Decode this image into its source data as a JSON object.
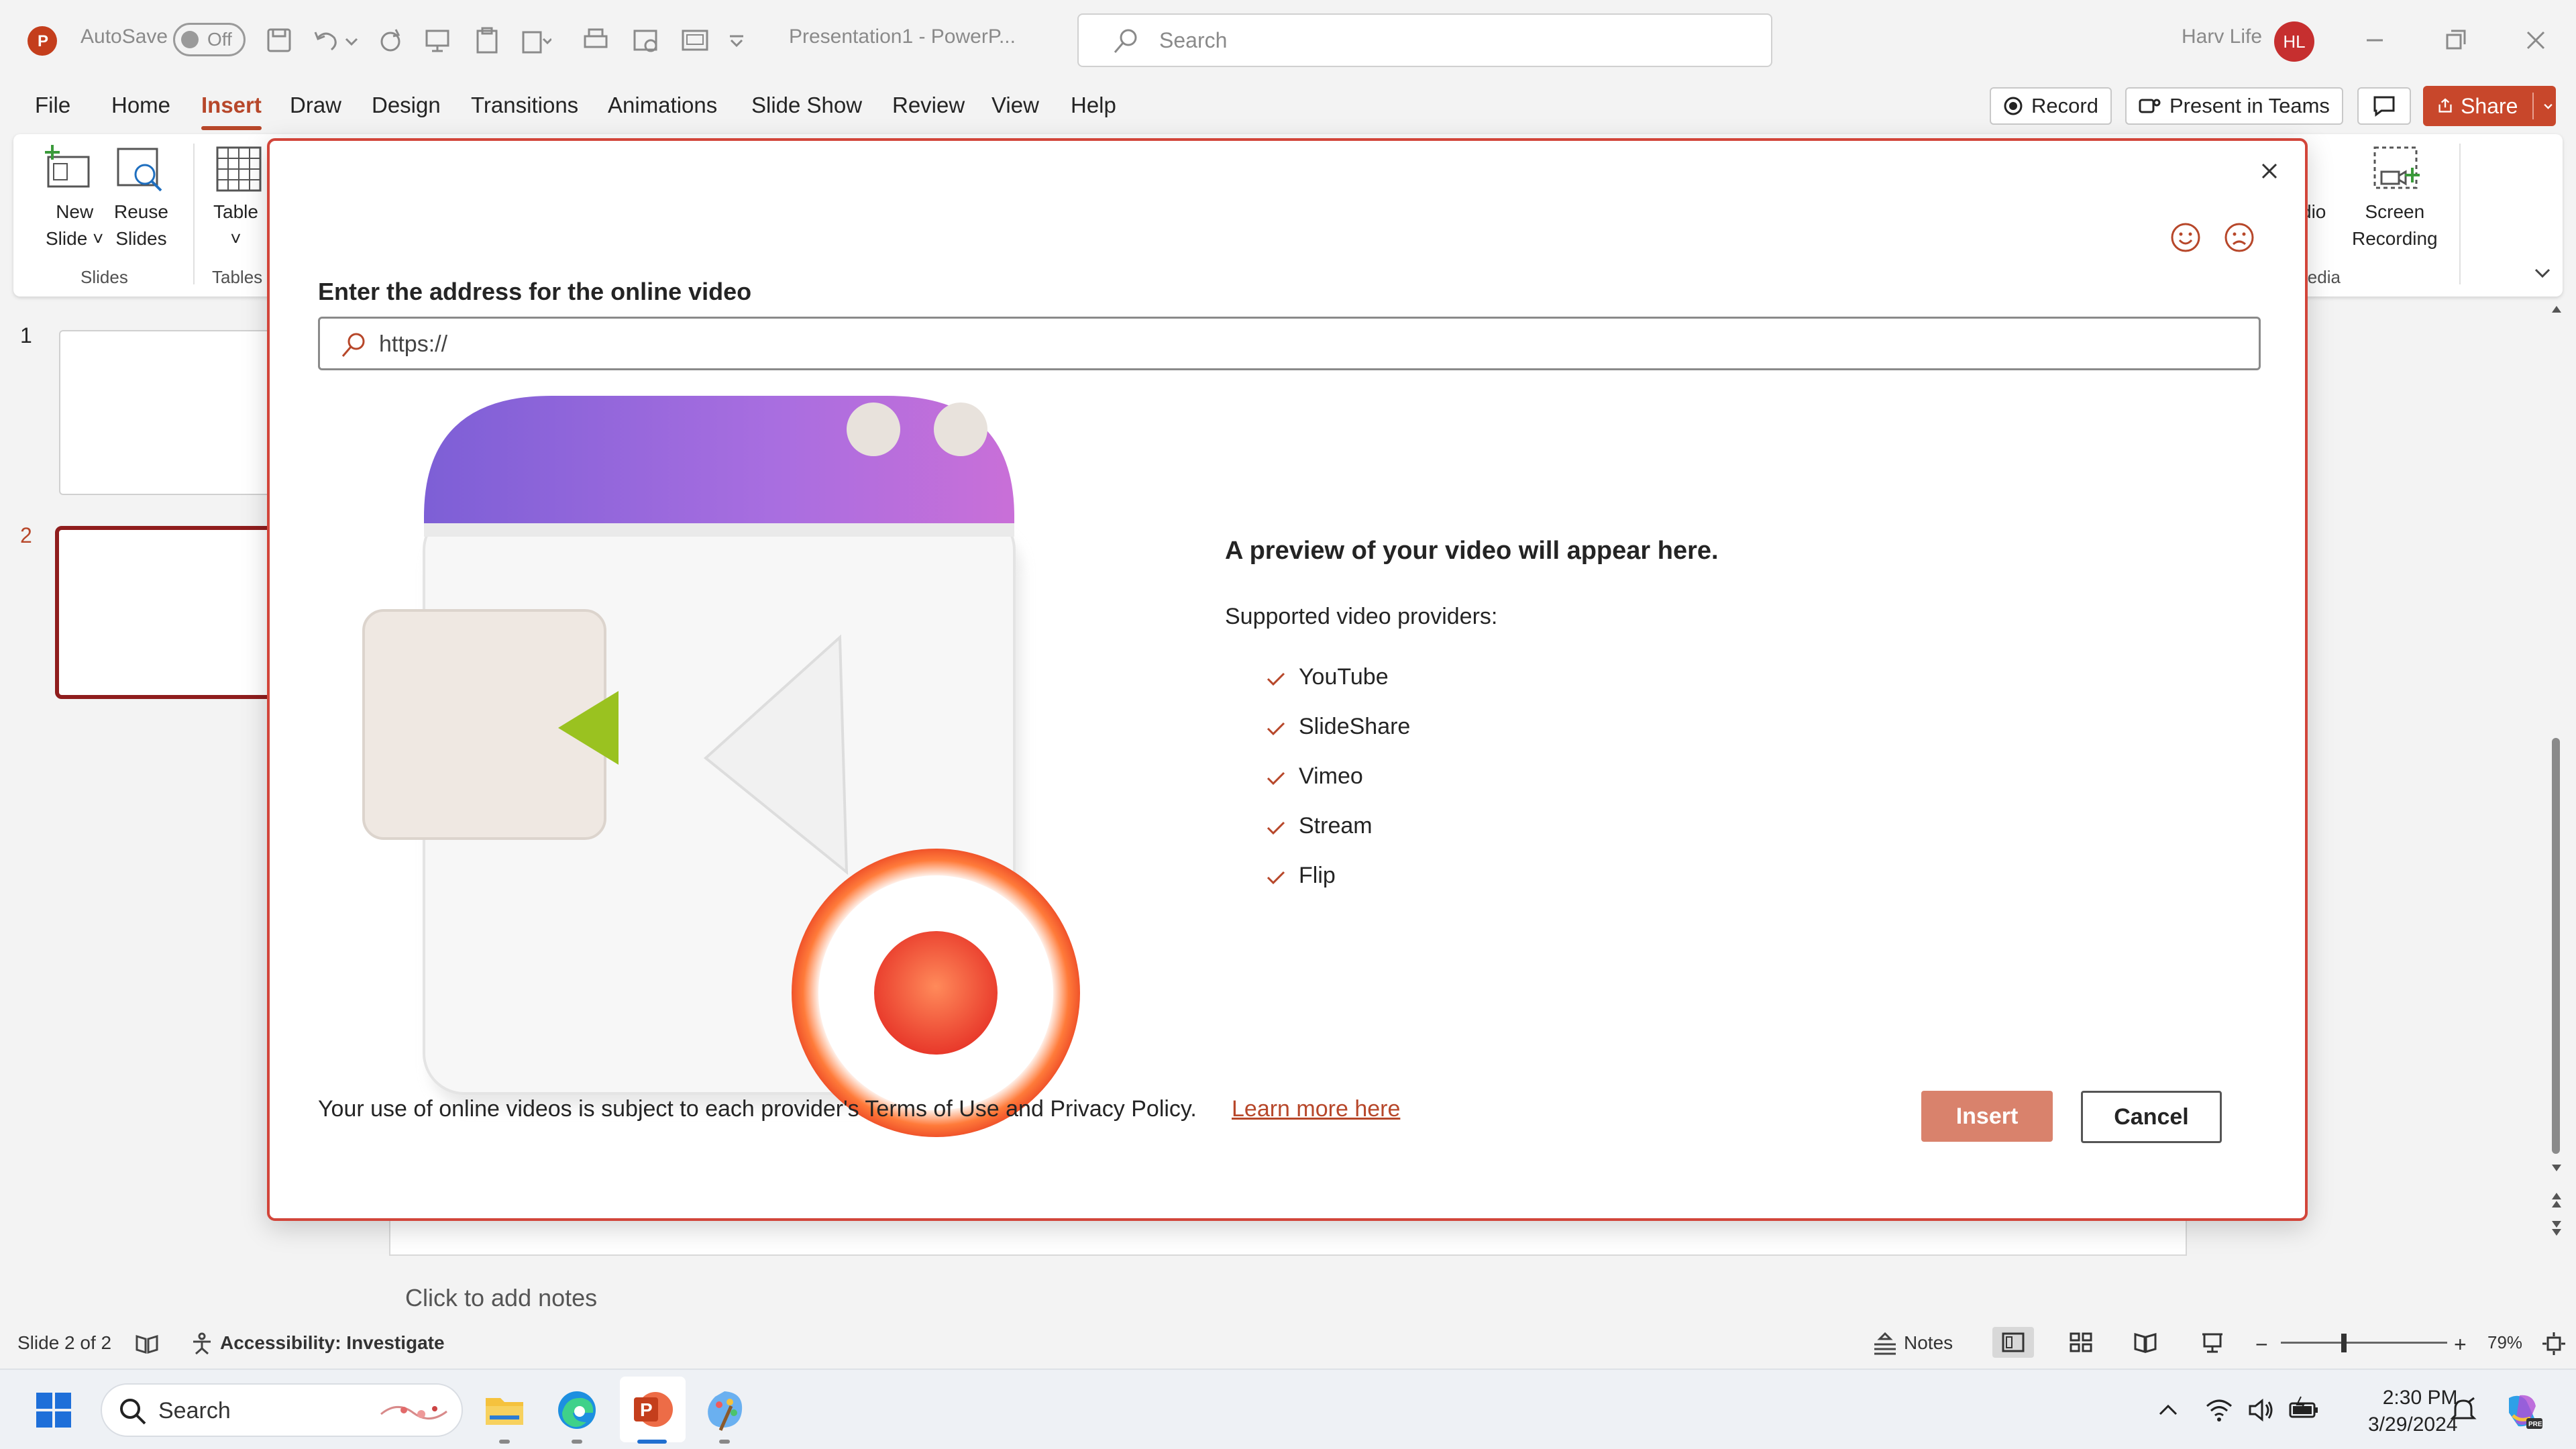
{
  "titlebar": {
    "autosave_label": "AutoSave",
    "autosave_state": "Off",
    "doc_title": "Presentation1 - PowerP...",
    "search_placeholder": "Search",
    "user_name": "Harv Life",
    "user_initials": "HL"
  },
  "menu": {
    "items": [
      "File",
      "Home",
      "Insert",
      "Draw",
      "Design",
      "Transitions",
      "Animations",
      "Slide Show",
      "Review",
      "View",
      "Help"
    ],
    "active": "Insert",
    "record_label": "Record",
    "present_label": "Present in Teams",
    "share_label": "Share"
  },
  "ribbon": {
    "new_slide_line1": "New",
    "new_slide_line2": "Slide",
    "reuse_line1": "Reuse",
    "reuse_line2": "Slides",
    "table_label": "Table",
    "group_slides": "Slides",
    "group_tables": "Tables",
    "audio_partial": "dio",
    "screen_rec_line1": "Screen",
    "screen_rec_line2": "Recording",
    "group_media_partial": "ledia"
  },
  "thumbnails": [
    {
      "number": "1"
    },
    {
      "number": "2"
    }
  ],
  "notes_placeholder": "Click to add notes",
  "statusbar": {
    "slide_info": "Slide 2 of 2",
    "accessibility": "Accessibility: Investigate",
    "notes_label": "Notes",
    "zoom": "79%"
  },
  "taskbar": {
    "search_placeholder": "Search",
    "time": "2:30 PM",
    "date": "3/29/2024"
  },
  "dialog": {
    "url_label": "Enter the address for the online video",
    "url_placeholder": "https://",
    "preview_title": "A preview of your video will appear here.",
    "providers_label": "Supported video providers:",
    "providers": [
      "YouTube",
      "SlideShare",
      "Vimeo",
      "Stream",
      "Flip"
    ],
    "terms_text": "Your use of online videos is subject to each provider's Terms of Use and Privacy Policy.",
    "learn_more": "Learn more here",
    "insert_label": "Insert",
    "cancel_label": "Cancel"
  },
  "colors": {
    "accent": "#b7472a",
    "dialog_border": "#d2453a",
    "insert_button": "#d9826c",
    "selected_thumb": "#8f1d1d"
  }
}
